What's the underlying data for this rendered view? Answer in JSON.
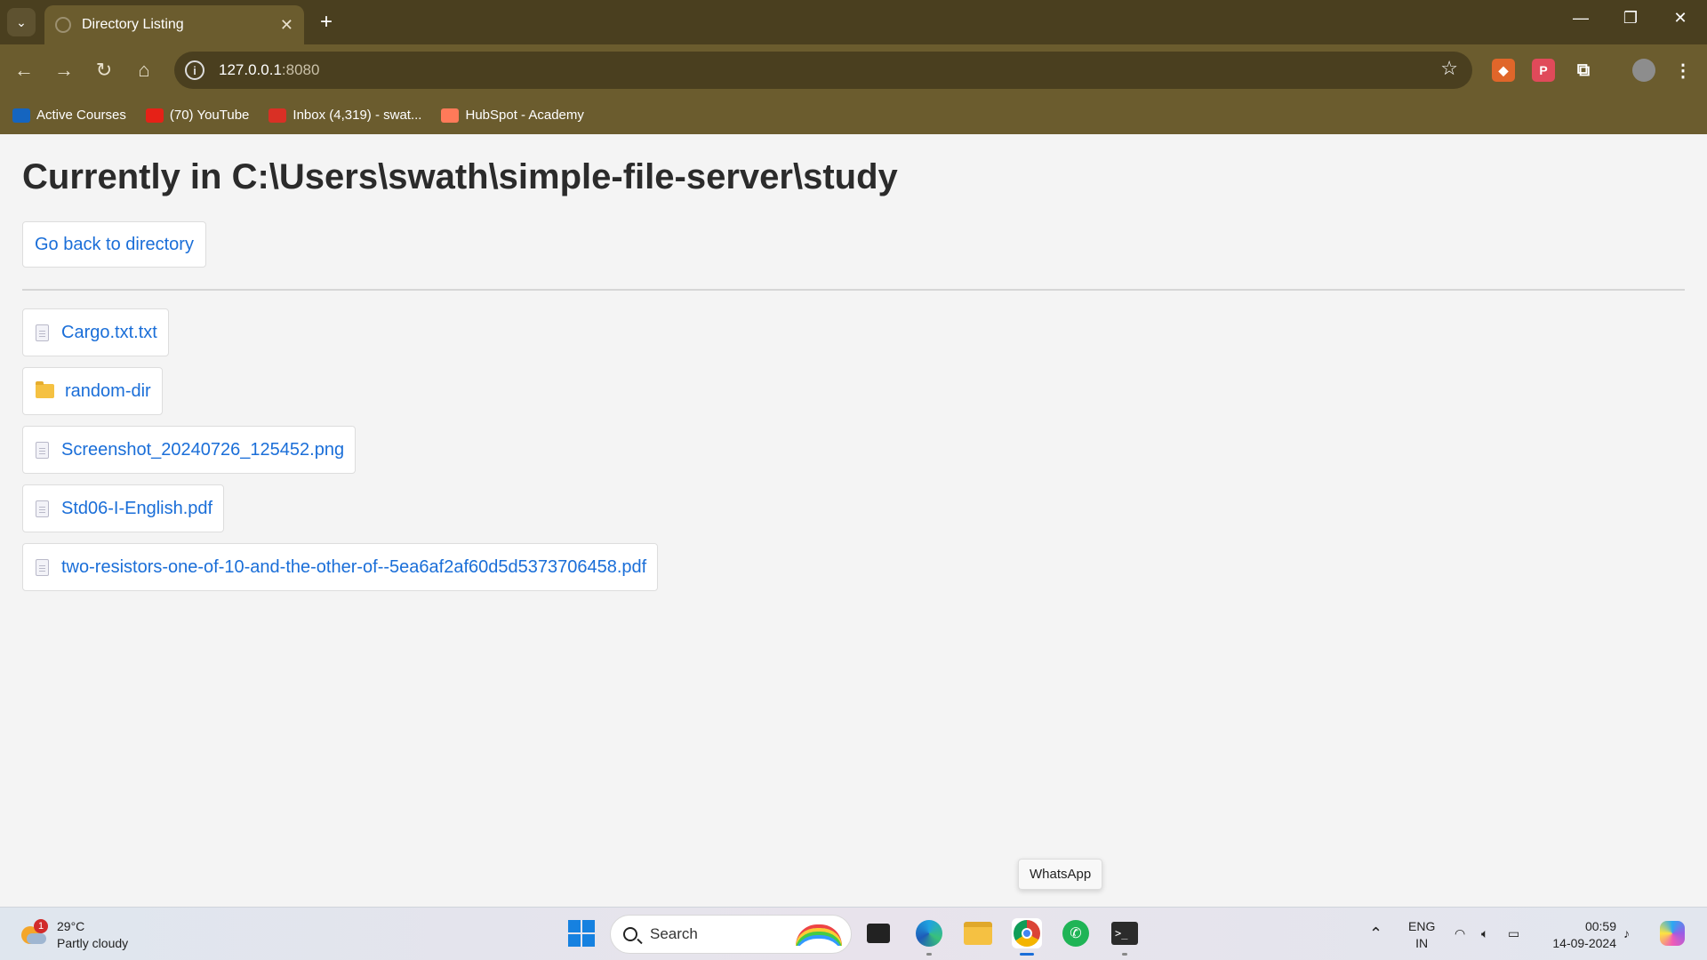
{
  "browser": {
    "tab_title": "Directory Listing",
    "url_host": "127.0.0.1",
    "url_port": ":8080",
    "bookmarks": [
      {
        "label": "Active Courses",
        "icon": "ep-icon",
        "color": "#1565c0"
      },
      {
        "label": "(70) YouTube",
        "icon": "youtube-icon",
        "color": "#e62117"
      },
      {
        "label": "Inbox (4,319) - swat...",
        "icon": "gmail-icon",
        "color": "#d93025"
      },
      {
        "label": "HubSpot - Academy",
        "icon": "hubspot-icon",
        "color": "#ff7a59"
      }
    ]
  },
  "page": {
    "heading": "Currently in C:\\Users\\swath\\simple-file-server\\study",
    "back_button": "Go back to directory",
    "entries": [
      {
        "name": "Cargo.txt.txt",
        "type": "file"
      },
      {
        "name": "random-dir",
        "type": "folder"
      },
      {
        "name": "Screenshot_20240726_125452.png",
        "type": "file"
      },
      {
        "name": "Std06-I-English.pdf",
        "type": "file"
      },
      {
        "name": "two-resistors-one-of-10-and-the-other-of--5ea6af2af60d5d5373706458.pdf",
        "type": "file"
      }
    ],
    "link_color": "#1a6ed8"
  },
  "tooltip": "WhatsApp",
  "taskbar": {
    "weather_badge": "1",
    "temperature": "29°C",
    "condition": "Partly cloudy",
    "search_placeholder": "Search",
    "lang_line1": "ENG",
    "lang_line2": "IN",
    "time": "00:59",
    "date": "14-09-2024"
  }
}
